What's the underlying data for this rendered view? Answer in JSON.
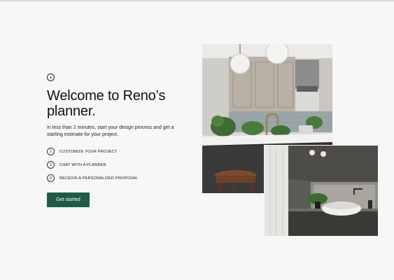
{
  "page": {
    "title": "Welcome to Reno’s planner.",
    "description": "In less than 2 minutes, start your design process and get a starting estimate for your project."
  },
  "steps": [
    {
      "number": "1",
      "label": "CUSTOMIZE YOUR PROJECT"
    },
    {
      "number": "2",
      "label": "CHAT WITH A PLANNER"
    },
    {
      "number": "3",
      "label": "RECEIVE A PERSONALIZED PROPOSAL"
    }
  ],
  "cta": {
    "label": "Get started"
  },
  "icons": {
    "back": "back-arrow-icon"
  },
  "colors": {
    "accent": "#1f5b48",
    "background": "#f7f7f7",
    "text": "#111111"
  }
}
